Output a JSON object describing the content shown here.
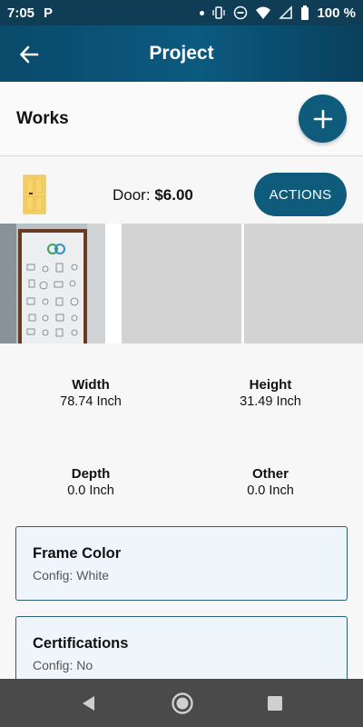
{
  "status_bar": {
    "time": "7:05",
    "notification_badge": "P",
    "battery": "100 %",
    "icons": [
      "dot",
      "vibrate-icon",
      "dnd-icon",
      "wifi-icon",
      "signal-icon",
      "battery-icon"
    ]
  },
  "app_bar": {
    "title": "Project",
    "back_icon": "arrow-left-icon"
  },
  "works": {
    "label": "Works",
    "add_icon": "plus-icon"
  },
  "item": {
    "type_label": "Door:",
    "price": "$6.00",
    "actions_label": "ACTIONS",
    "icon": "door-icon"
  },
  "dimensions": {
    "width": {
      "label": "Width",
      "value": "78.74 Inch"
    },
    "height": {
      "label": "Height",
      "value": "31.49 Inch"
    },
    "depth": {
      "label": "Depth",
      "value": "0.0 Inch"
    },
    "other": {
      "label": "Other",
      "value": "0.0 Inch"
    }
  },
  "cards": [
    {
      "title": "Frame Color",
      "subtitle": "Config: White"
    },
    {
      "title": "Certifications",
      "subtitle": "Config: No"
    }
  ],
  "colors": {
    "primary": "#0f5b7c",
    "appbar": "#0a4a6a",
    "card_bg": "#eef6fc",
    "card_border": "#2b5f7a"
  },
  "nav": {
    "icons": [
      "back-triangle-icon",
      "home-circle-icon",
      "recents-square-icon"
    ]
  }
}
